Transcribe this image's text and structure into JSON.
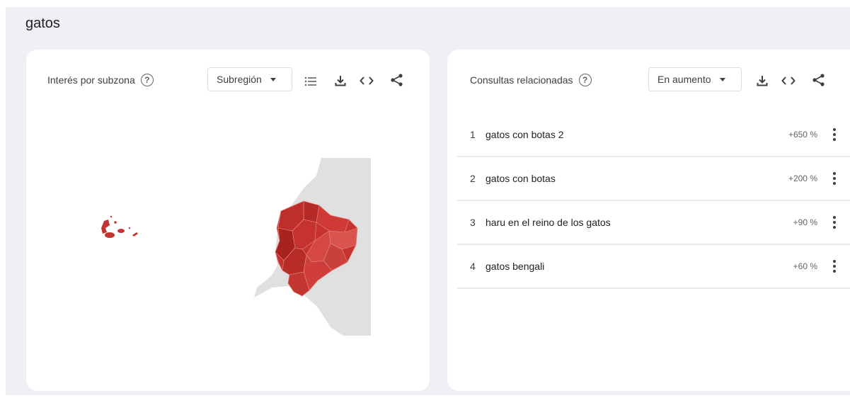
{
  "search_term": "gatos",
  "left_card": {
    "title": "Interés por subzona",
    "help_icon": "help-circle-icon",
    "resolution_select": "Subregión",
    "icons": [
      "list-icon",
      "download-icon",
      "embed-code-icon",
      "share-icon"
    ]
  },
  "right_card": {
    "title": "Consultas relacionadas",
    "help_icon": "help-circle-icon",
    "filter_select": "En aumento",
    "icons": [
      "download-icon",
      "embed-code-icon",
      "share-icon"
    ],
    "queries": [
      {
        "rank": "1",
        "text": "gatos con botas 2",
        "value": "+650 %"
      },
      {
        "rank": "2",
        "text": "gatos con botas",
        "value": "+200 %"
      },
      {
        "rank": "3",
        "text": "haru en el reino de los gatos",
        "value": "+90 %"
      },
      {
        "rank": "4",
        "text": "gatos bengali",
        "value": "+60 %"
      }
    ]
  },
  "colors": {
    "page_background": "#eef0f6",
    "map_region": "#c5322f",
    "map_region_light": "#d9534f",
    "map_neighbor": "#e0e0e0",
    "divider": "#e8eaed"
  }
}
